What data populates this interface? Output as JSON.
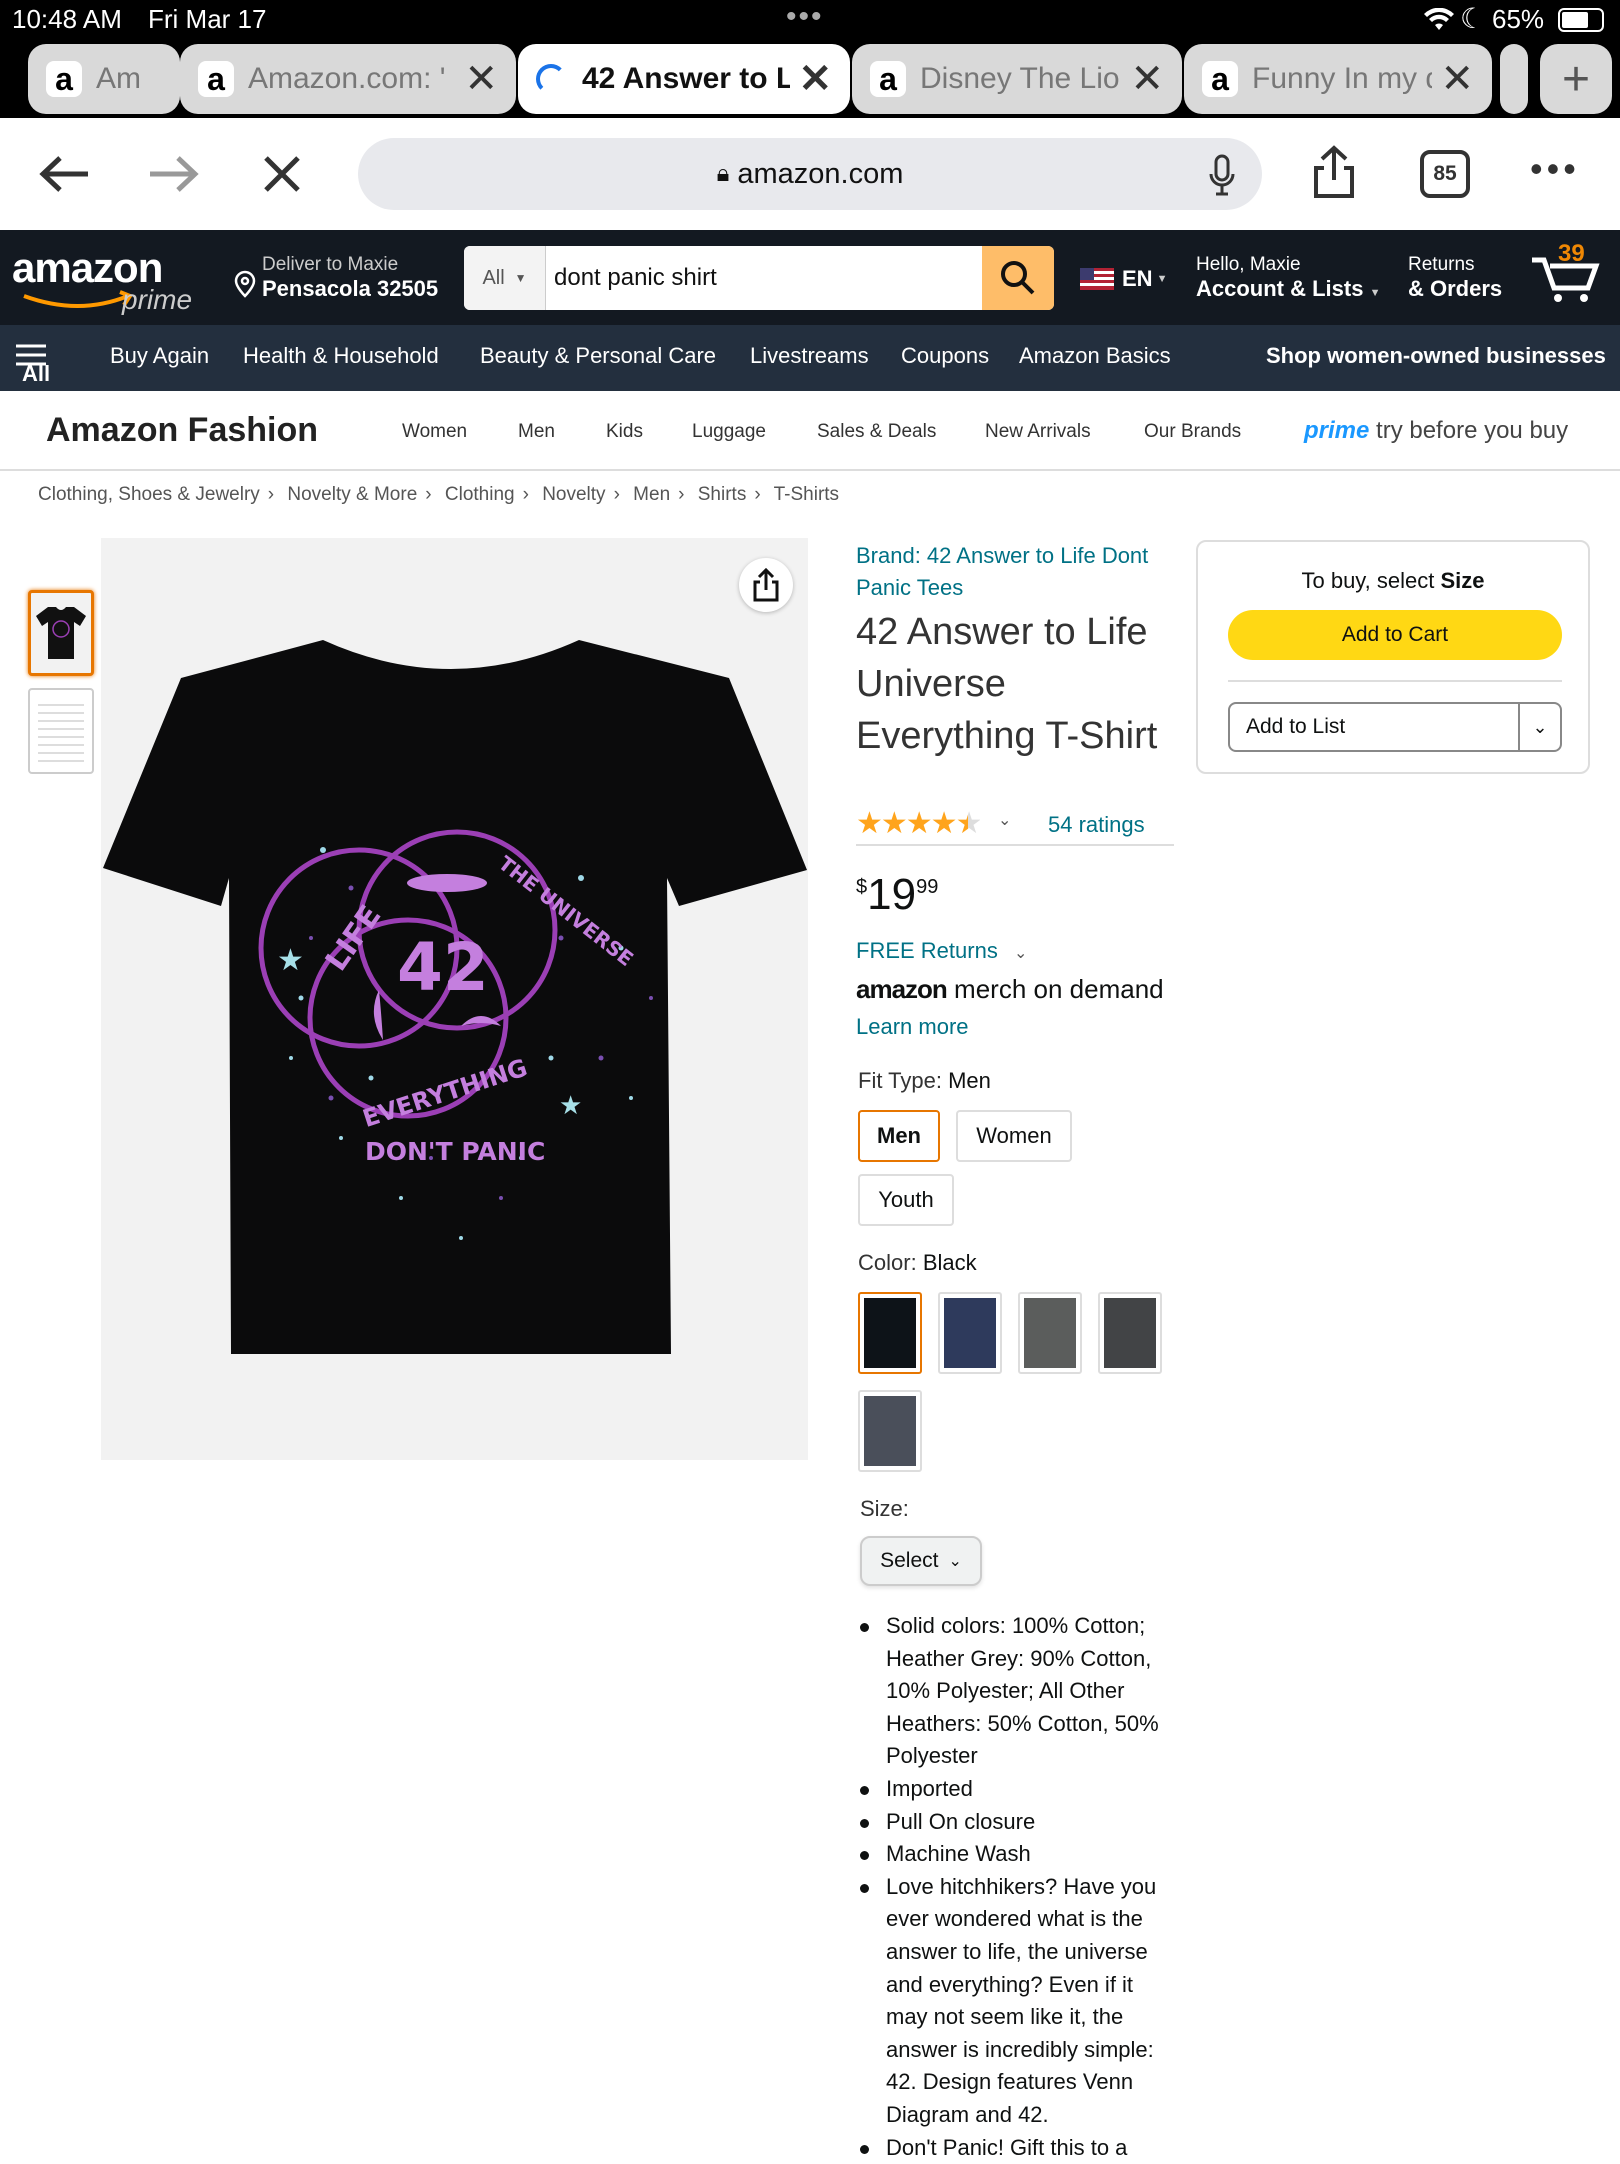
{
  "status": {
    "time": "10:48 AM",
    "date": "Fri Mar 17",
    "battery": "65%"
  },
  "tabs": [
    {
      "label": "Am",
      "active": false
    },
    {
      "label": "Amazon.com: '",
      "active": false
    },
    {
      "label": "42 Answer to L",
      "active": true
    },
    {
      "label": "Disney The Lio",
      "active": false
    },
    {
      "label": "Funny In my dc",
      "active": false
    }
  ],
  "browser": {
    "url": "amazon.com",
    "tab_count": "85"
  },
  "header": {
    "logo": "amazon",
    "logo_sub": "prime",
    "deliver_line1": "Deliver to Maxie",
    "deliver_line2": "Pensacola 32505",
    "search_category": "All",
    "search_value": "dont panic shirt",
    "lang": "EN",
    "hello": "Hello, Maxie",
    "account": "Account & Lists",
    "returns": "Returns",
    "orders": "& Orders",
    "cart_count": "39"
  },
  "nav": {
    "all": "All",
    "items": [
      "Buy Again",
      "Health & Household",
      "Beauty & Personal Care",
      "Livestreams",
      "Coupons",
      "Amazon Basics"
    ],
    "promo": "Shop women-owned businesses"
  },
  "fashion": {
    "title": "Amazon Fashion",
    "links": [
      "Women",
      "Men",
      "Kids",
      "Luggage",
      "Sales & Deals",
      "New Arrivals",
      "Our Brands"
    ],
    "prime_word": "prime",
    "prime_rest": "try before you buy"
  },
  "breadcrumb": [
    "Clothing, Shoes & Jewelry",
    "Novelty & More",
    "Clothing",
    "Novelty",
    "Men",
    "Shirts",
    "T-Shirts"
  ],
  "product": {
    "brand": "Brand: 42 Answer to Life Dont Panic Tees",
    "title": "42 Answer to Life Universe Everything T-Shirt",
    "rating_stars": 4.5,
    "ratings": "54 ratings",
    "price_symbol": "$",
    "price_whole": "19",
    "price_fraction": "99",
    "free_returns": "FREE Returns",
    "merch_word1": "amazon",
    "merch_word2": "merch on demand",
    "learn_more": "Learn more",
    "fit_label": "Fit Type:",
    "fit_value": "Men",
    "fit_options": [
      "Men",
      "Women",
      "Youth"
    ],
    "color_label": "Color:",
    "color_value": "Black",
    "colors": [
      "#0d1318",
      "#2e3a5c",
      "#5b5d5c",
      "#424446",
      "#4a4f5a"
    ],
    "size_label": "Size:",
    "size_select": "Select",
    "bullets": [
      "Solid colors: 100% Cotton; Heather Grey: 90% Cotton, 10% Polyester; All Other Heathers: 50% Cotton, 50% Polyester",
      "Imported",
      "Pull On closure",
      "Machine Wash",
      "Love hitchhikers? Have you ever wondered what is the answer to life, the universe and everything? Even if it may not seem like it, the answer is incredibly simple: 42. Design features Venn Diagram and 42.",
      "Don't Panic! Gift this to a"
    ],
    "shirt_text": {
      "life": "LIFE",
      "universe": "THE UNIVERSE",
      "everything": "EVERYTHING",
      "number": "42",
      "tagline": "DON'T PANIC"
    }
  },
  "buybox": {
    "prompt_pre": "To buy, select ",
    "prompt_bold": "Size",
    "add_to_cart": "Add to Cart",
    "add_to_list": "Add to List"
  }
}
